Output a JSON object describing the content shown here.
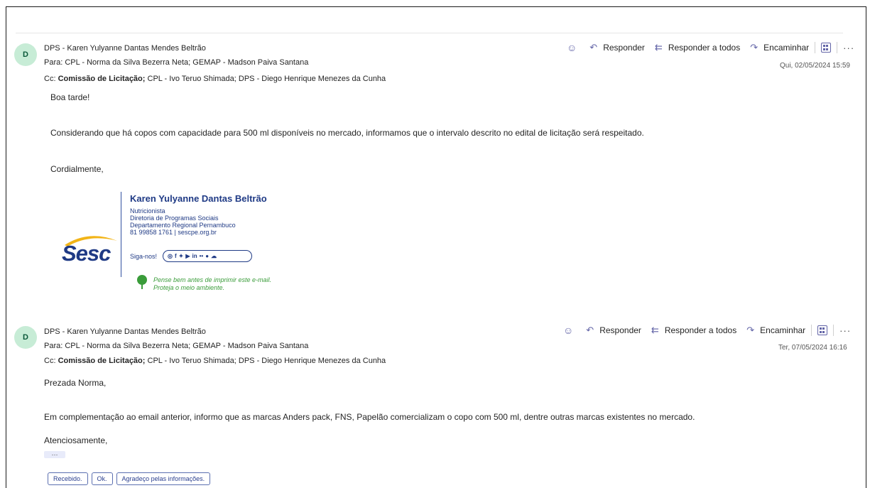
{
  "messages": [
    {
      "avatar_initial": "D",
      "sender": "DPS - Karen Yulyanne Dantas Mendes Beltrão",
      "to": "Para:  CPL - Norma da Silva Bezerra Neta;  GEMAP - Madson Paiva Santana",
      "cc_label": "Cc: ",
      "cc_bold": "Comissão de Licitação;",
      "cc_rest": "  CPL - Ivo Teruo Shimada;  DPS - Diego Henrique Menezes da Cunha",
      "date": "Qui, 02/05/2024 15:59",
      "body": [
        "Boa tarde!",
        "Considerando que há copos com capacidade para 500 ml disponíveis no mercado, informamos que o intervalo descrito no edital de licitação será respeitado.",
        "Cordialmente,"
      ]
    },
    {
      "avatar_initial": "D",
      "sender": "DPS - Karen Yulyanne Dantas Mendes Beltrão",
      "to": "Para:  CPL - Norma da Silva Bezerra Neta;  GEMAP - Madson Paiva Santana",
      "cc_label": "Cc: ",
      "cc_bold": "Comissão de Licitação;",
      "cc_rest": "  CPL - Ivo Teruo Shimada;  DPS - Diego Henrique Menezes da Cunha",
      "date": "Ter, 07/05/2024 16:16",
      "body": [
        "Prezada Norma,",
        "Em complementação ao email anterior, informo que as marcas Anders pack, FNS, Papelão comercializam o copo com 500 ml, dentre outras marcas existentes no mercado.",
        "Atenciosamente,"
      ]
    }
  ],
  "actions": {
    "reply": "Responder",
    "reply_all": "Responder a todos",
    "forward": "Encaminhar",
    "more": "···"
  },
  "signature": {
    "logo": "Sesc",
    "name": "Karen Yulyanne Dantas Beltrão",
    "role": "Nutricionista",
    "dept1": "Diretoria de Programas Sociais",
    "dept2": "Departamento Regional Pernambuco",
    "contact": "81 99858 1761 | sescpe.org.br",
    "follow": "Siga-nos!",
    "eco1": "Pense bem antes de imprimir este e-mail.",
    "eco2": "Proteja o meio ambiente."
  },
  "ellipsis": "···",
  "quick_replies": [
    "Recebido.",
    "Ok.",
    "Agradeço pelas informações."
  ],
  "colors": {
    "accent": "#6264a7",
    "avatar_bg": "#c7ecd6",
    "signature_blue": "#1f3a85",
    "signature_green": "#3a9c3a",
    "sesc_yellow": "#f2b417"
  }
}
